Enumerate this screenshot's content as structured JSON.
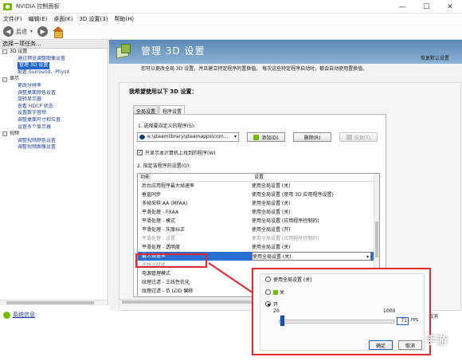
{
  "window": {
    "title": "NVIDIA 控制面板",
    "controls": [
      "—",
      "☐",
      "✕"
    ]
  },
  "menu": [
    "文件(F)",
    "编辑(E)",
    "桌面(K)",
    "3D 设置(3)",
    "帮助(H)"
  ],
  "toolbar": {
    "back_label": "后退",
    "back_glyph": "◀",
    "forward_glyph": "▶",
    "caret": "▾"
  },
  "left": {
    "header": "选择一项任务...",
    "tree": [
      {
        "type": "cat",
        "toggle": "□",
        "label": "3D 设置"
      },
      {
        "type": "child",
        "label": "通过预览调整图像设置"
      },
      {
        "type": "child",
        "label": "管理 3D 设置",
        "selected": true
      },
      {
        "type": "child",
        "label": "配置 Surround、PhysX"
      },
      {
        "type": "cat",
        "toggle": "□",
        "label": "显示"
      },
      {
        "type": "child",
        "label": "更改分辨率"
      },
      {
        "type": "child",
        "label": "调整桌面颜色设置"
      },
      {
        "type": "child",
        "label": "旋转显示器"
      },
      {
        "type": "child",
        "label": "查看 HDCP 状态"
      },
      {
        "type": "child",
        "label": "设置数字音频"
      },
      {
        "type": "child",
        "label": "调整桌面尺寸和位置"
      },
      {
        "type": "child",
        "label": "设置多个显示器"
      },
      {
        "type": "cat",
        "toggle": "□",
        "label": "视频"
      },
      {
        "type": "child",
        "label": "调整视频颜色设置"
      },
      {
        "type": "child",
        "label": "调整视频图像设置"
      }
    ],
    "sysinfo": "系统信息"
  },
  "main": {
    "title": "管理 3D 设置",
    "restore": "恢复默认设置",
    "intro": "您可以更改全局 3D 设置，并且建立特定程序的置换值。 每次这些特定程序启动时，都会自动使用置换值。",
    "question": "我希望使用以下 3D 设置：",
    "tabs": [
      "全局设置",
      "程序设置"
    ],
    "step1": "1. 选择要自定义的程序(S):",
    "program": "e:\\steamlibrary\\steamapps\\com...",
    "add": "添加(D)",
    "remove": "删除(R)",
    "restore_btn": "恢复(T)",
    "only_show": "只显示本计算机上找到的程序(W)",
    "step2": "2. 指定该程序的设置(O):",
    "col_feature": "功能",
    "col_setting": "设置",
    "rows": [
      {
        "f": "后台应用程序最大帧速率",
        "s": "使用全局设置 (关)"
      },
      {
        "f": "垂直同步",
        "s": "使用全局设置 (使用 3D 应用程序设置)"
      },
      {
        "f": "多帧采样 AA (MFAA)",
        "s": "使用全局设置 (关)"
      },
      {
        "f": "平滑处理 - FXAA",
        "s": "使用全局设置 (关)"
      },
      {
        "f": "平滑处理 - 模式",
        "s": "使用全局设置 (应用程序控制的)"
      },
      {
        "f": "平滑处理 - 灰度纠正",
        "s": "使用全局设置 (开)"
      },
      {
        "f": "平滑处理 - 设置",
        "s": "使用全局设置 (应用程序控制的)",
        "dim": true
      },
      {
        "f": "平滑处理 - 透明度",
        "s": "使用全局设置 (关)"
      },
      {
        "f": "最大帧速率",
        "s": "使用全局设置 (关)",
        "sel": true
      },
      {
        "f": "环境光吸收",
        "s": "",
        "dim": true
      },
      {
        "f": "电源管理模式",
        "s": ""
      },
      {
        "f": "纹理过滤 - 三线性优化",
        "s": ""
      },
      {
        "f": "纹理过滤 - 负 LOD 偏移",
        "s": ""
      }
    ],
    "cancel_peek": "取消"
  },
  "popup": {
    "options": [
      "使用全局设置 (关)",
      "关",
      "开"
    ],
    "selected_index": 2,
    "min": "20",
    "max": "1000",
    "value_fraction": 0.012,
    "fps_value": "71",
    "fps_unit": "FPS",
    "ok": "确定",
    "cancel": "取消"
  },
  "watermark": "手游",
  "colors": {
    "accent_red": "#e0262e",
    "nvidia_green": "#76b900",
    "header_blue": "#5b88b5",
    "select_blue": "#2a6ed1"
  }
}
